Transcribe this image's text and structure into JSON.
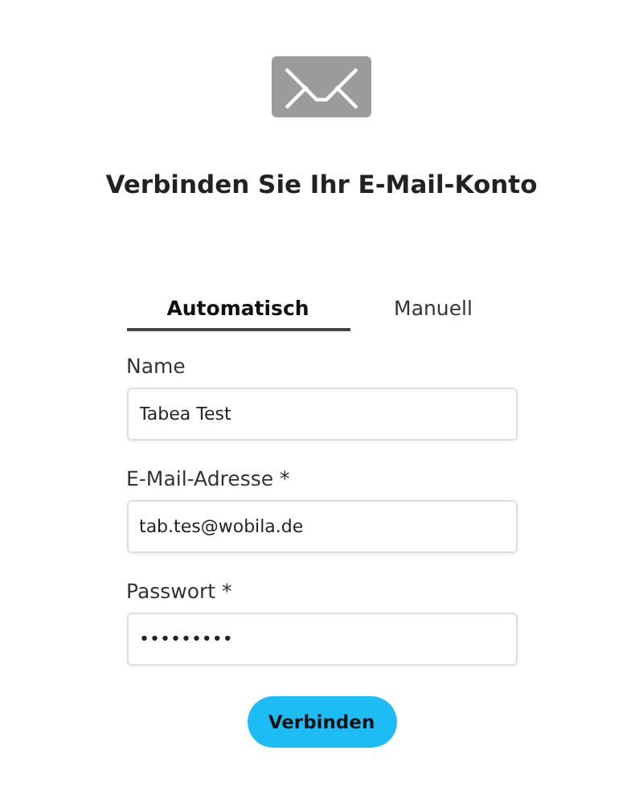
{
  "title": "Verbinden Sie Ihr E-Mail-Konto",
  "tabs": [
    {
      "label": "Automatisch",
      "selected": true
    },
    {
      "label": "Manuell",
      "selected": false
    }
  ],
  "fields": [
    {
      "label": "Name",
      "value": "Tabea Test"
    },
    {
      "label": "E-Mail-Adresse *",
      "value": "tab.tes@wobila.de"
    },
    {
      "label": "Passwort *",
      "value": "•••••••••"
    }
  ],
  "button": "Verbinden"
}
